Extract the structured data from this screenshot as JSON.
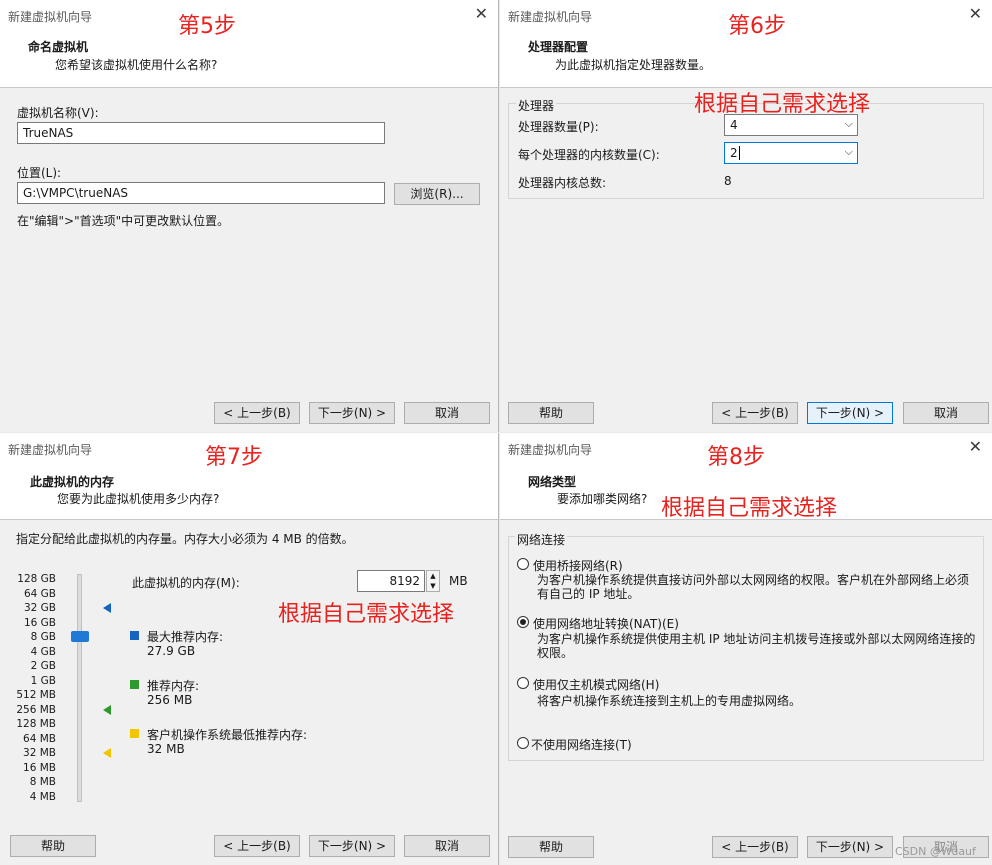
{
  "wizard_title": "新建虚拟机向导",
  "close_glyph": "✕",
  "requirement_note": "根据自己需求选择",
  "buttons": {
    "back": "< 上一步(B)",
    "next": "下一步(N) >",
    "cancel": "取消",
    "help": "帮助",
    "browse": "浏览(R)..."
  },
  "step5": {
    "step_label": "第5步",
    "title": "命名虚拟机",
    "subtitle": "您希望该虚拟机使用什么名称?",
    "name_label": "虚拟机名称(V):",
    "name_value": "TrueNAS",
    "location_label": "位置(L):",
    "location_value": "G:\\VMPC\\trueNAS",
    "hint": "在\"编辑\">\"首选项\"中可更改默认位置。"
  },
  "step6": {
    "step_label": "第6步",
    "title": "处理器配置",
    "subtitle": "为此虚拟机指定处理器数量。",
    "group_label": "处理器",
    "count_label": "处理器数量(P):",
    "count_value": "4",
    "cores_label": "每个处理器的内核数量(C):",
    "cores_value": "2",
    "total_label": "处理器内核总数:",
    "total_value": "8"
  },
  "step7": {
    "step_label": "第7步",
    "title": "此虚拟机的内存",
    "subtitle": "您要为此虚拟机使用多少内存?",
    "instruction": "指定分配给此虚拟机的内存量。内存大小必须为 4 MB 的倍数。",
    "memory_label": "此虚拟机的内存(M):",
    "memory_value": "8192",
    "memory_unit": "MB",
    "scale": [
      "128 GB",
      "64 GB",
      "32 GB",
      "16 GB",
      "8 GB",
      "4 GB",
      "2 GB",
      "1 GB",
      "512 MB",
      "256 MB",
      "128 MB",
      "64 MB",
      "32 MB",
      "16 MB",
      "8 MB",
      "4 MB"
    ],
    "max_label": "最大推荐内存:",
    "max_value": "27.9 GB",
    "rec_label": "推荐内存:",
    "rec_value": "256 MB",
    "min_label": "客户机操作系统最低推荐内存:",
    "min_value": "32 MB",
    "colors": {
      "max": "#1565c0",
      "rec": "#2e9a2e",
      "min": "#f2c500"
    }
  },
  "step8": {
    "step_label": "第8步",
    "title": "网络类型",
    "subtitle": "要添加哪类网络?",
    "group_label": "网络连接",
    "options": [
      {
        "label": "使用桥接网络(R)",
        "desc": "为客户机操作系统提供直接访问外部以太网网络的权限。客户机在外部网络上必须有自己的 IP 地址。",
        "selected": false
      },
      {
        "label": "使用网络地址转换(NAT)(E)",
        "desc": "为客户机操作系统提供使用主机 IP 地址访问主机拨号连接或外部以太网网络连接的权限。",
        "selected": true
      },
      {
        "label": "使用仅主机模式网络(H)",
        "desc": "将客户机操作系统连接到主机上的专用虚拟网络。",
        "selected": false
      },
      {
        "label": "不使用网络连接(T)",
        "desc": "",
        "selected": false
      }
    ],
    "watermark": "CSDN @Wuauf"
  }
}
